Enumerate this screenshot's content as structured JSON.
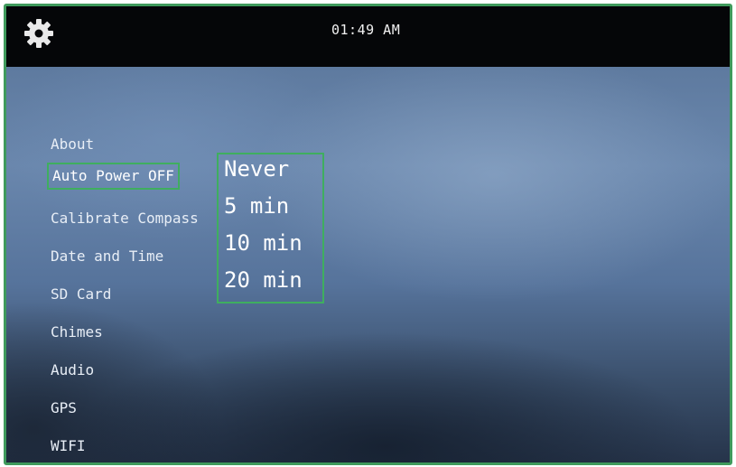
{
  "status_bar": {
    "settings_icon": "gear-icon",
    "time": "01:49 AM"
  },
  "menu": {
    "items": [
      {
        "label": "About"
      },
      {
        "label": "Auto Power OFF",
        "selected": true
      },
      {
        "label": "Calibrate Compass"
      },
      {
        "label": "Date and Time"
      },
      {
        "label": "SD Card"
      },
      {
        "label": "Chimes"
      },
      {
        "label": "Audio"
      },
      {
        "label": "GPS"
      },
      {
        "label": "WIFI"
      }
    ]
  },
  "auto_power_off_options": [
    "Never",
    "5 min",
    "10 min",
    "20 min"
  ],
  "colors": {
    "highlight_border": "#3fae5f",
    "frame_border": "#3f9a5c",
    "top_bar": "#050608"
  }
}
